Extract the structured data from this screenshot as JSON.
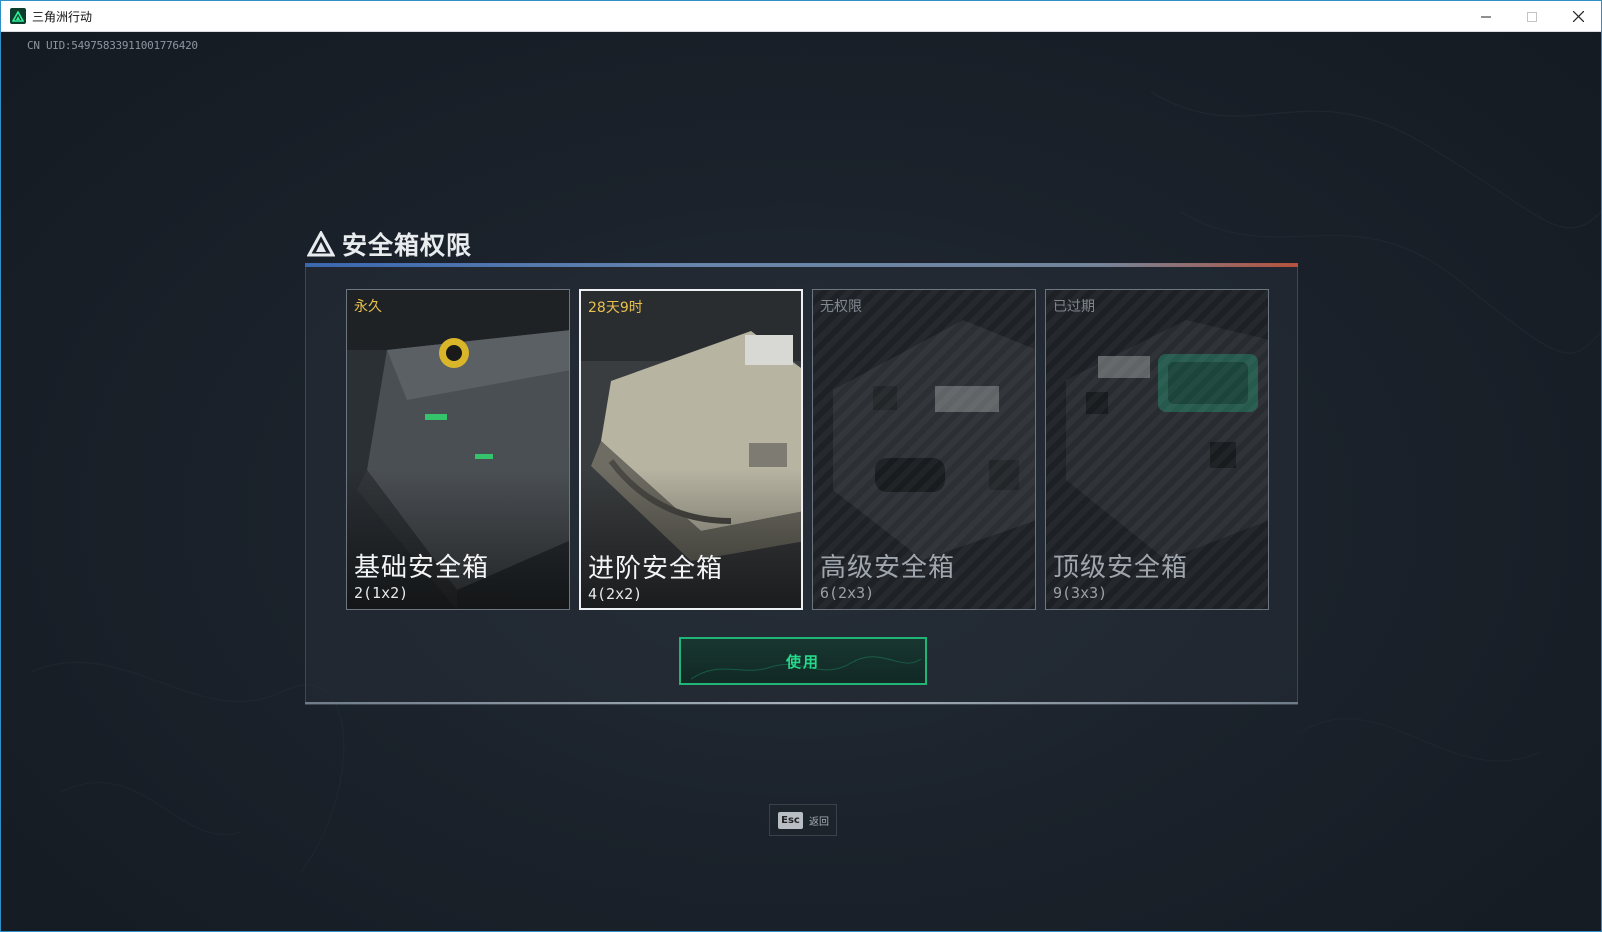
{
  "window": {
    "title": "三角洲行动",
    "minimize_icon": "minimize-icon",
    "maximize_icon": "maximize-icon",
    "close_icon": "close-icon"
  },
  "uid_text": "CN UID:549758339110017764​20",
  "dialog": {
    "title": "安全箱权限",
    "cards": [
      {
        "status": "永久",
        "name": "基础安全箱",
        "capacity": "2(1x2)",
        "available": true,
        "selected": false
      },
      {
        "status": "28天9时",
        "name": "进阶安全箱",
        "capacity": "4(2x2)",
        "available": true,
        "selected": true
      },
      {
        "status": "无权限",
        "name": "高级安全箱",
        "capacity": "6(2x3)",
        "available": false,
        "selected": false
      },
      {
        "status": "已过期",
        "name": "顶级安全箱",
        "capacity": "9(3x3)",
        "available": false,
        "selected": false
      }
    ],
    "use_button": "使用"
  },
  "esc_hint": {
    "key": "Esc",
    "label": "返回"
  },
  "colors": {
    "accent_green": "#25d98b",
    "status_gold": "#e9c04e",
    "title_bar_border": "#2e8fc9"
  }
}
